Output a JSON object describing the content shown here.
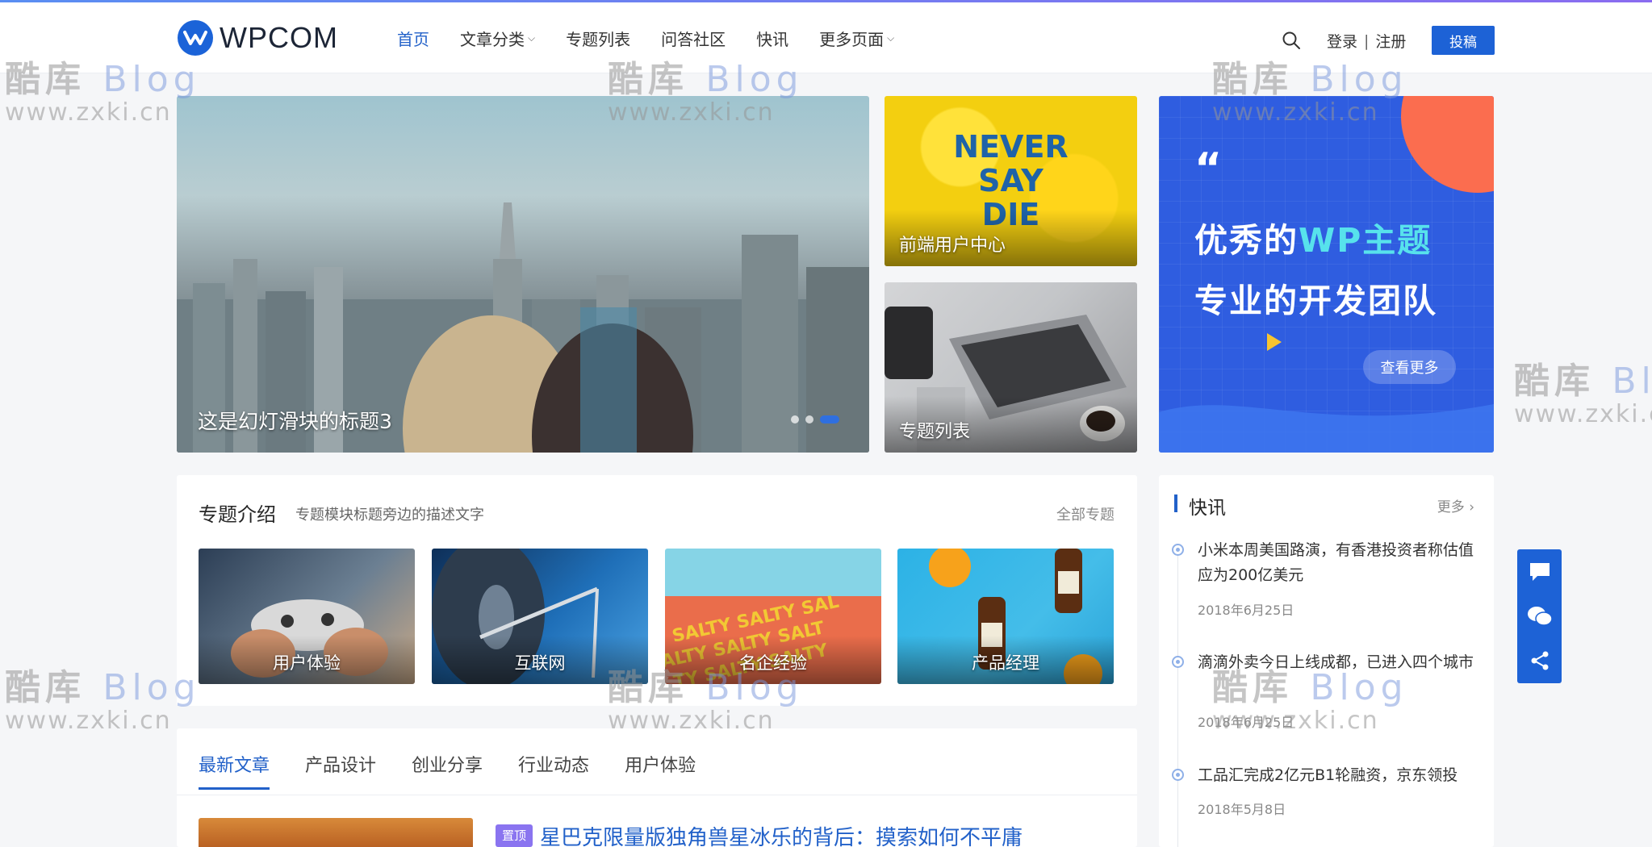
{
  "header": {
    "logo_text": "WPCOM",
    "nav": [
      {
        "label": "首页",
        "active": true,
        "has_dropdown": false
      },
      {
        "label": "文章分类",
        "active": false,
        "has_dropdown": true
      },
      {
        "label": "专题列表",
        "active": false,
        "has_dropdown": false
      },
      {
        "label": "问答社区",
        "active": false,
        "has_dropdown": false
      },
      {
        "label": "快讯",
        "active": false,
        "has_dropdown": false
      },
      {
        "label": "更多页面",
        "active": false,
        "has_dropdown": true
      }
    ],
    "login_label": "登录",
    "separator": "|",
    "register_label": "注册",
    "submit_label": "投稿"
  },
  "hero": {
    "title": "这是幻灯滑块的标题3",
    "slide_count": 3,
    "active_slide": 3
  },
  "side_cards": {
    "card1_poster_text": [
      "NEVER",
      "SAY",
      "DIE"
    ],
    "card1_title": "前端用户中心",
    "card2_title": "专题列表"
  },
  "promo": {
    "quote_mark": "“",
    "line1_prefix": "优秀的",
    "line1_highlight": "WP主题",
    "line2": "专业的开发团队",
    "button_label": "查看更多",
    "colors": {
      "background": "#2f5de0",
      "accent": "#57e2ec",
      "blob": "#fb6d4f"
    }
  },
  "topics": {
    "title": "专题介绍",
    "description": "专题模块标题旁边的描述文字",
    "all_label": "全部专题",
    "items": [
      {
        "label": "用户体验"
      },
      {
        "label": "互联网"
      },
      {
        "label": "名企经验"
      },
      {
        "label": "产品经理"
      }
    ]
  },
  "latest": {
    "tabs": [
      {
        "label": "最新文章",
        "active": true
      },
      {
        "label": "产品设计",
        "active": false
      },
      {
        "label": "创业分享",
        "active": false
      },
      {
        "label": "行业动态",
        "active": false
      },
      {
        "label": "用户体验",
        "active": false
      }
    ],
    "first_article": {
      "badge": "置顶",
      "title": "星巴克限量版独角兽星冰乐的背后：摸索如何不平庸"
    }
  },
  "flash": {
    "title": "快讯",
    "more_label": "更多",
    "items": [
      {
        "text": "小米本周美国路演，有香港投资者称估值应为200亿美元",
        "date": "2018年6月25日"
      },
      {
        "text": "滴滴外卖今日上线成都，已进入四个城市",
        "date": "2018年6月25日"
      },
      {
        "text": "工品汇完成2亿元B1轮融资，京东领投",
        "date": "2018年5月8日"
      }
    ]
  },
  "float_bar": {
    "icons": [
      "comments-icon",
      "wechat-icon",
      "share-icon"
    ],
    "color": "#1d62d6"
  },
  "watermark": {
    "line1_cn": "酷库",
    "line1_en": "Blog",
    "line2": "www.zxki.cn"
  },
  "colors": {
    "brand": "#1d62d6",
    "link": "#2261c9",
    "page_bg": "#f5f6f8"
  }
}
